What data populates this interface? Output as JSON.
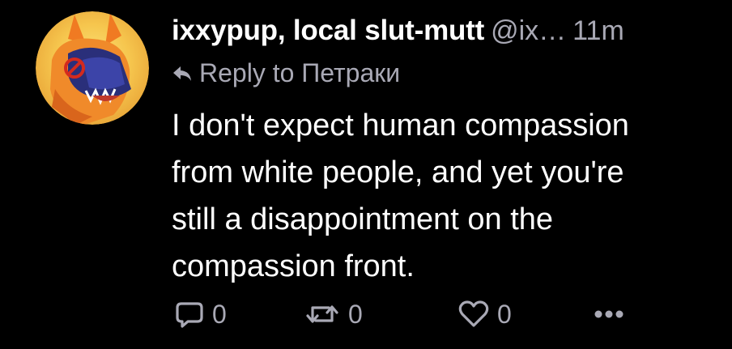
{
  "post": {
    "author": {
      "display_name": "ixxypup, local slut-mutt",
      "handle": "@ix…",
      "avatar_icon": "dragon-avatar-icon"
    },
    "timestamp": "11m",
    "reply_to": {
      "icon": "reply-arrow-icon",
      "text": "Reply to Петраки"
    },
    "content_lines": [
      "I don't expect human compassion",
      "from white people, and yet you're",
      "still a disappointment on the",
      "compassion front."
    ],
    "actions": {
      "reply": {
        "icon": "reply-bubble-icon",
        "count": "0"
      },
      "repost": {
        "icon": "repost-icon",
        "count": "0"
      },
      "like": {
        "icon": "heart-icon",
        "count": "0"
      },
      "more": {
        "icon": "more-dots-icon"
      }
    },
    "colors": {
      "background": "#000000",
      "text_primary": "#ffffff",
      "text_secondary": "#a9a9b5"
    }
  }
}
